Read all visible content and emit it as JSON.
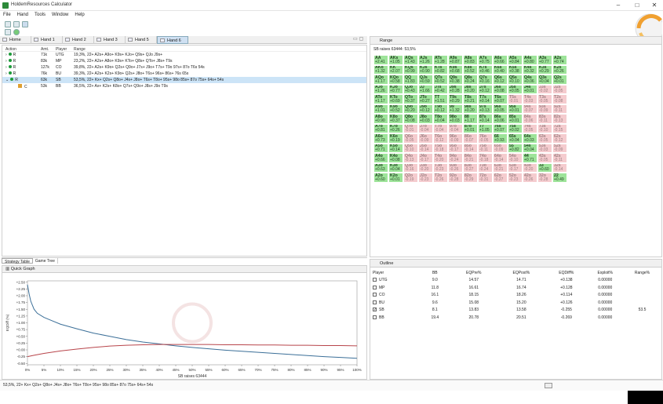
{
  "window": {
    "title": "HoldemResources Calculator",
    "minimize": "–",
    "maximize": "□",
    "close": "✕"
  },
  "menu": [
    "File",
    "Hand",
    "Tools",
    "Window",
    "Help"
  ],
  "tabs": [
    "Home",
    "Hand 1",
    "Hand 2",
    "Hand 3",
    "Hand 5",
    "Hand 6"
  ],
  "actions": {
    "headers": [
      "Action",
      "Amt.",
      "Player",
      "Range"
    ],
    "rows": [
      {
        "action": "R",
        "amt": "71k",
        "player": "UTG",
        "range": "19,3%, 22+ A2s+ A9o+ K9s+ KJo+ Q9s+ QJo J9s+"
      },
      {
        "action": "R",
        "amt": "83k",
        "player": "MP",
        "range": "23,2%, 22+ A2s+ A8o+ K9s+ KTo+ Q8s+ QTo+ J8s+ T9s"
      },
      {
        "action": "R",
        "amt": "127k",
        "player": "CO",
        "range": "39,8%, 22+ A2s+ K9o+ Q2s+ Q9o+ J7s+ J9o+ T7s+ T9o 97s+ 87o T6s 54s"
      },
      {
        "action": "R",
        "amt": "76k",
        "player": "BU",
        "range": "39,3%, 22+ A2s+ K2s+ K9o+ Q2s+ J8o+ T6s+ 96s+ 86s+ 76s 65s"
      },
      {
        "action": "R",
        "amt": "63k",
        "player": "SB",
        "range": "53,5%, 22+ Kx+ Q2s+ Q8o+ J4s+ J8o+ T6s+ T8o+ 95s+ 98o 85s+ 87o 75s+ 64s+ 54s"
      },
      {
        "action": "C",
        "amt": "53k",
        "player": "BB",
        "range": "36,5%, 22+ Ax+ K2s+ K8o+ Q7s+ Q9o+ J8s+ J9o T9s"
      }
    ]
  },
  "bottom_tabs": [
    "Strategy Table",
    "Game Tree"
  ],
  "quick_graph": {
    "title": "Quick Graph"
  },
  "status_text": "53,5%, 22+ Kx+ Q2s+ Q8o+ J4s+ J8o+ T6s+ T8o+ 95s+ 98o 85s+ 87o 75s+ 64s+ 54s",
  "range_panel": {
    "title": "Range",
    "subtitle": "SB raises 63444: 53,5%"
  },
  "grid": [
    [
      "AA",
      "+2.41",
      "g"
    ],
    [
      "AKs",
      "+1.05",
      "g"
    ],
    [
      "AQs",
      "+1.43",
      "g"
    ],
    [
      "AJs",
      "+1.26",
      "g"
    ],
    [
      "ATs",
      "+1.28",
      "g"
    ],
    [
      "A9s",
      "+0.87",
      "g"
    ],
    [
      "A8s",
      "+0.83",
      "g"
    ],
    [
      "A7s",
      "+0.75",
      "g"
    ],
    [
      "A6s",
      "+0.66",
      "g"
    ],
    [
      "A5s",
      "+0.84",
      "g"
    ],
    [
      "A4s",
      "+0.80",
      "g"
    ],
    [
      "A3s",
      "+0.77",
      "g"
    ],
    [
      "A2s",
      "+0.74",
      "g"
    ],
    [
      "AKo",
      "+1.32",
      "g"
    ],
    [
      "KK",
      "+2.07",
      "g"
    ],
    [
      "KQs",
      "+0.99",
      "g"
    ],
    [
      "KJs",
      "+0.90",
      "g"
    ],
    [
      "KTs",
      "+0.82",
      "g"
    ],
    [
      "K9s",
      "+0.68",
      "g"
    ],
    [
      "K8s",
      "+0.52",
      "g"
    ],
    [
      "K7s",
      "+0.46",
      "g"
    ],
    [
      "K6s",
      "+0.40",
      "g"
    ],
    [
      "K5s",
      "+0.38",
      "g"
    ],
    [
      "K4s",
      "+0.32",
      "g"
    ],
    [
      "K3s",
      "+0.29",
      "g"
    ],
    [
      "K2s",
      "+0.26",
      "g"
    ],
    [
      "AQo",
      "+1.17",
      "g"
    ],
    [
      "KQo",
      "+0.58",
      "g"
    ],
    [
      "QQ",
      "+1.83",
      "g"
    ],
    [
      "QJs",
      "+0.59",
      "g"
    ],
    [
      "QTs",
      "+0.52",
      "g"
    ],
    [
      "Q9s",
      "+0.38",
      "g"
    ],
    [
      "Q8s",
      "+0.24",
      "g"
    ],
    [
      "Q7s",
      "+0.16",
      "g"
    ],
    [
      "Q6s",
      "+0.12",
      "g"
    ],
    [
      "Q5s",
      "+0.10",
      "g"
    ],
    [
      "Q4s",
      "+0.06",
      "g"
    ],
    [
      "Q3s",
      "+0.04",
      "g"
    ],
    [
      "Q2s",
      "+0.01",
      "g"
    ],
    [
      "AJo",
      "+1.26",
      "g"
    ],
    [
      "KJo",
      "+0.77",
      "g"
    ],
    [
      "QJo",
      "+0.43",
      "g"
    ],
    [
      "JJ",
      "+1.66",
      "g"
    ],
    [
      "JTs",
      "+0.42",
      "g"
    ],
    [
      "J9s",
      "+0.28",
      "g"
    ],
    [
      "J8s",
      "+0.20",
      "g"
    ],
    [
      "J7s",
      "+0.12",
      "g"
    ],
    [
      "J6s",
      "+0.08",
      "g"
    ],
    [
      "J5s",
      "+0.05",
      "g"
    ],
    [
      "J4s",
      "+0.01",
      "g"
    ],
    [
      "J3s",
      "-0.02",
      "p"
    ],
    [
      "J2s",
      "-0.05",
      "p"
    ],
    [
      "ATo",
      "+1.17",
      "g"
    ],
    [
      "KTo",
      "+0.69",
      "g"
    ],
    [
      "QTo",
      "+0.37",
      "g"
    ],
    [
      "JTo",
      "+0.27",
      "g"
    ],
    [
      "TT",
      "+1.51",
      "g"
    ],
    [
      "T9s",
      "+0.29",
      "g"
    ],
    [
      "T8s",
      "+0.21",
      "g"
    ],
    [
      "T7s",
      "+0.14",
      "g"
    ],
    [
      "T6s",
      "+0.07",
      "g"
    ],
    [
      "T5s",
      "-0.01",
      "p"
    ],
    [
      "T4s",
      "-0.03",
      "p"
    ],
    [
      "T3s",
      "-0.05",
      "p"
    ],
    [
      "T2s",
      "-0.08",
      "p"
    ],
    [
      "A9o",
      "+1.01",
      "g"
    ],
    [
      "K9o",
      "+0.52",
      "g"
    ],
    [
      "Q9o",
      "+0.20",
      "g"
    ],
    [
      "J9o",
      "+0.12",
      "g"
    ],
    [
      "T9o",
      "+0.12",
      "g"
    ],
    [
      "99",
      "+1.32",
      "g"
    ],
    [
      "98s",
      "+0.20",
      "g"
    ],
    [
      "97s",
      "+0.13",
      "g"
    ],
    [
      "96s",
      "+0.05",
      "g"
    ],
    [
      "95s",
      "+0.01",
      "g"
    ],
    [
      "94s",
      "-0.07",
      "p"
    ],
    [
      "93s",
      "-0.09",
      "p"
    ],
    [
      "92s",
      "-0.11",
      "p"
    ],
    [
      "A8o",
      "+0.90",
      "g"
    ],
    [
      "K8o",
      "+0.37",
      "g"
    ],
    [
      "Q8o",
      "+0.08",
      "g"
    ],
    [
      "J8o",
      "+0.03",
      "g"
    ],
    [
      "T8o",
      "+0.04",
      "g"
    ],
    [
      "98o",
      "+0.03",
      "g"
    ],
    [
      "88",
      "+1.17",
      "g"
    ],
    [
      "87s",
      "+0.14",
      "g"
    ],
    [
      "86s",
      "+0.06",
      "g"
    ],
    [
      "85s",
      "+0.01",
      "g"
    ],
    [
      "84s",
      "-0.06",
      "p"
    ],
    [
      "83s",
      "-0.11",
      "p"
    ],
    [
      "82s",
      "-0.13",
      "p"
    ],
    [
      "A7o",
      "+0.81",
      "g"
    ],
    [
      "K7o",
      "+0.26",
      "g"
    ],
    [
      "Q7o",
      "-0.01",
      "p"
    ],
    [
      "J7o",
      "-0.04",
      "p"
    ],
    [
      "T7o",
      "-0.04",
      "p"
    ],
    [
      "97o",
      "-0.04",
      "p"
    ],
    [
      "87o",
      "+0.01",
      "g"
    ],
    [
      "77",
      "+1.05",
      "g"
    ],
    [
      "76s",
      "+0.07",
      "g"
    ],
    [
      "75s",
      "+0.02",
      "g"
    ],
    [
      "74s",
      "-0.05",
      "p"
    ],
    [
      "73s",
      "-0.10",
      "p"
    ],
    [
      "72s",
      "-0.15",
      "p"
    ],
    [
      "A6o",
      "+0.73",
      "g"
    ],
    [
      "K6o",
      "+0.19",
      "g"
    ],
    [
      "Q6o",
      "-0.05",
      "p"
    ],
    [
      "J6o",
      "-0.09",
      "p"
    ],
    [
      "T6o",
      "-0.12",
      "p"
    ],
    [
      "96o",
      "-0.09",
      "p"
    ],
    [
      "86o",
      "-0.07",
      "p"
    ],
    [
      "76o",
      "-0.05",
      "p"
    ],
    [
      "66",
      "+0.93",
      "g"
    ],
    [
      "65s",
      "+0.04",
      "g"
    ],
    [
      "64s",
      "+0.03",
      "g"
    ],
    [
      "63s",
      "-0.05",
      "p"
    ],
    [
      "62s",
      "-0.12",
      "p"
    ],
    [
      "A5o",
      "+0.71",
      "g"
    ],
    [
      "K5o",
      "+0.14",
      "g"
    ],
    [
      "Q5o",
      "-0.10",
      "p"
    ],
    [
      "J5o",
      "-0.14",
      "p"
    ],
    [
      "T5o",
      "-0.18",
      "p"
    ],
    [
      "95o",
      "-0.17",
      "p"
    ],
    [
      "85o",
      "-0.14",
      "p"
    ],
    [
      "75o",
      "-0.11",
      "p"
    ],
    [
      "65o",
      "-0.09",
      "p"
    ],
    [
      "55",
      "+0.82",
      "g"
    ],
    [
      "54s",
      "+0.04",
      "g"
    ],
    [
      "53s",
      "-0.03",
      "p"
    ],
    [
      "52s",
      "-0.09",
      "p"
    ],
    [
      "A4o",
      "+0.66",
      "g"
    ],
    [
      "K4o",
      "+0.08",
      "g"
    ],
    [
      "Q4o",
      "-0.13",
      "p"
    ],
    [
      "J4o",
      "-0.17",
      "p"
    ],
    [
      "T4o",
      "-0.20",
      "p"
    ],
    [
      "94o",
      "-0.24",
      "p"
    ],
    [
      "84o",
      "-0.21",
      "p"
    ],
    [
      "74o",
      "-0.18",
      "p"
    ],
    [
      "64o",
      "-0.14",
      "p"
    ],
    [
      "54o",
      "-0.10",
      "p"
    ],
    [
      "44",
      "+0.71",
      "g"
    ],
    [
      "43s",
      "-0.05",
      "p"
    ],
    [
      "42s",
      "-0.11",
      "p"
    ],
    [
      "A3o",
      "+0.63",
      "g"
    ],
    [
      "K3o",
      "+0.04",
      "g"
    ],
    [
      "Q3o",
      "-0.16",
      "p"
    ],
    [
      "J3o",
      "-0.20",
      "p"
    ],
    [
      "T3o",
      "-0.23",
      "p"
    ],
    [
      "93o",
      "-0.26",
      "p"
    ],
    [
      "83o",
      "-0.27",
      "p"
    ],
    [
      "73o",
      "-0.24",
      "p"
    ],
    [
      "63o",
      "-0.21",
      "p"
    ],
    [
      "53o",
      "-0.17",
      "p"
    ],
    [
      "43o",
      "-0.20",
      "p"
    ],
    [
      "33",
      "+0.60",
      "g"
    ],
    [
      "32s",
      "-0.14",
      "p"
    ],
    [
      "A2o",
      "+0.60",
      "g"
    ],
    [
      "K2o",
      "+0.01",
      "g"
    ],
    [
      "Q2o",
      "-0.19",
      "p"
    ],
    [
      "J2o",
      "-0.23",
      "p"
    ],
    [
      "T2o",
      "-0.26",
      "p"
    ],
    [
      "92o",
      "-0.28",
      "p"
    ],
    [
      "82o",
      "-0.29",
      "p"
    ],
    [
      "72o",
      "-0.31",
      "p"
    ],
    [
      "62o",
      "-0.27",
      "p"
    ],
    [
      "52o",
      "-0.23",
      "p"
    ],
    [
      "42o",
      "-0.26",
      "p"
    ],
    [
      "32o",
      "-0.28",
      "p"
    ],
    [
      "22",
      "+0.49",
      "g"
    ]
  ],
  "outline": {
    "title": "Outline",
    "headers": [
      "Player",
      "BB",
      "EQPre%",
      "EQPost%",
      "EQDiff%",
      "Exploit%",
      "Range%"
    ],
    "rows": [
      {
        "player": "UTG",
        "bb": "9.0",
        "pre": "14.57",
        "post": "14.71",
        "diff": "+0.138",
        "exploit": "0.00000",
        "range": "",
        "checked": false
      },
      {
        "player": "MP",
        "bb": "11.8",
        "pre": "16.61",
        "post": "16.74",
        "diff": "+0.128",
        "exploit": "0.00000",
        "range": "",
        "checked": false
      },
      {
        "player": "CO",
        "bb": "16.1",
        "pre": "18.15",
        "post": "18.26",
        "diff": "+0.114",
        "exploit": "0.00000",
        "range": "",
        "checked": false
      },
      {
        "player": "BU",
        "bb": "9.6",
        "pre": "15.08",
        "post": "15.20",
        "diff": "+0.126",
        "exploit": "0.00000",
        "range": "",
        "checked": false
      },
      {
        "player": "SB",
        "bb": "8.1",
        "pre": "13.83",
        "post": "13.58",
        "diff": "-0.255",
        "exploit": "0.00000",
        "range": "53.5",
        "checked": true
      },
      {
        "player": "BB",
        "bb": "19.4",
        "pre": "20.78",
        "post": "20.51",
        "diff": "-0.269",
        "exploit": "0.00000",
        "range": "",
        "checked": false
      }
    ]
  },
  "colors": {
    "green_cell": "#9ee49a",
    "pink_cell": "#f5cccf",
    "blue_line": "#3b6f98",
    "red_line": "#b8454b"
  },
  "chart_data": {
    "type": "line",
    "xlabel": "SB raises 63444",
    "ylabel": "EQDiff (%)",
    "x_ticks": [
      "0%",
      "5%",
      "10%",
      "15%",
      "20%",
      "25%",
      "30%",
      "35%",
      "40%",
      "45%",
      "50%",
      "55%",
      "60%",
      "65%",
      "70%",
      "75%",
      "80%",
      "85%",
      "90%",
      "95%",
      "100%"
    ],
    "y_ticks": [
      "+2.50",
      "+2.25",
      "+2.00",
      "+1.75",
      "+1.50",
      "+1.25",
      "+1.00",
      "+0.75",
      "+0.50",
      "+0.25",
      "+0.00",
      "-0.25",
      "-0.50"
    ],
    "ylim": [
      -0.55,
      2.55
    ],
    "series": [
      {
        "color": "#3b6f98",
        "x": [
          0,
          0.5,
          1,
          2,
          3,
          5,
          7,
          10,
          15,
          20,
          25,
          30,
          35,
          40,
          45,
          50,
          55,
          60,
          65,
          70,
          75,
          80,
          85,
          90,
          95,
          100
        ],
        "y": [
          2.41,
          2.07,
          1.8,
          1.5,
          1.35,
          1.2,
          1.1,
          0.95,
          0.78,
          0.62,
          0.5,
          0.38,
          0.29,
          0.22,
          0.15,
          0.09,
          0.04,
          -0.01,
          -0.05,
          -0.09,
          -0.13,
          -0.17,
          -0.21,
          -0.25,
          -0.28,
          -0.31
        ]
      },
      {
        "color": "#b8454b",
        "x": [
          0,
          2,
          5,
          10,
          15,
          20,
          25,
          30,
          35,
          40,
          45,
          50,
          55,
          60,
          65,
          70,
          75,
          80,
          85,
          90,
          95,
          100
        ],
        "y": [
          -0.25,
          -0.2,
          -0.13,
          -0.04,
          0.03,
          0.09,
          0.14,
          0.17,
          0.19,
          0.2,
          0.2,
          0.2,
          0.2,
          0.19,
          0.19,
          0.18,
          0.18,
          0.17,
          0.17,
          0.16,
          0.16,
          0.15
        ]
      }
    ]
  }
}
